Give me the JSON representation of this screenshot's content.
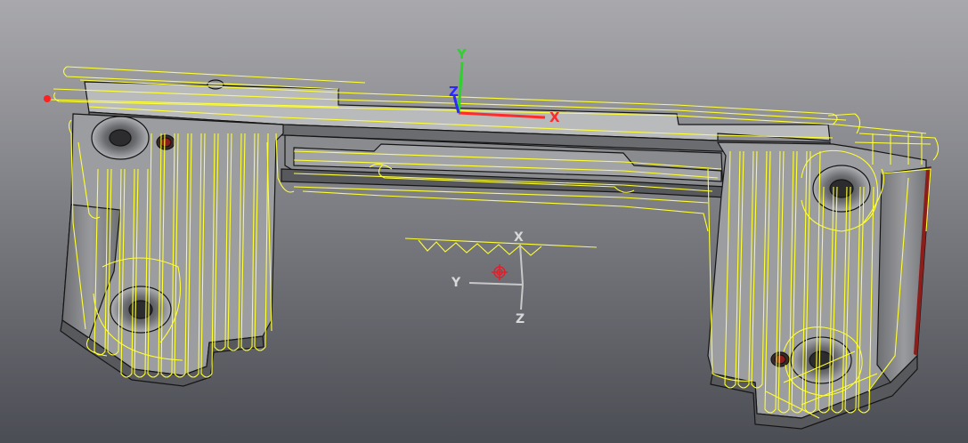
{
  "viewport": {
    "background_top": "#a9a9ad",
    "background_bottom": "#4b4d54",
    "part_fill": "#8d8e91",
    "part_top_fill": "#b7b8ba",
    "part_shadow": "#59595c",
    "part_edge": "#151515",
    "toolpath_color": "#ffff33",
    "hole_highlight": "#8b1e1a"
  },
  "world_axes": {
    "x_label": "X",
    "y_label": "Y",
    "z_label": "Z",
    "x_color": "#ff2a2a",
    "y_color": "#2ad42a",
    "z_color": "#2a2aff"
  },
  "view_triad": {
    "x_label": "X",
    "y_label": "Y",
    "z_label": "Z",
    "color": "#c8c8c8",
    "origin_icon": "origin-target-icon",
    "origin_color": "#e0202a"
  },
  "markers": {
    "start_point_color": "#ff2020"
  }
}
